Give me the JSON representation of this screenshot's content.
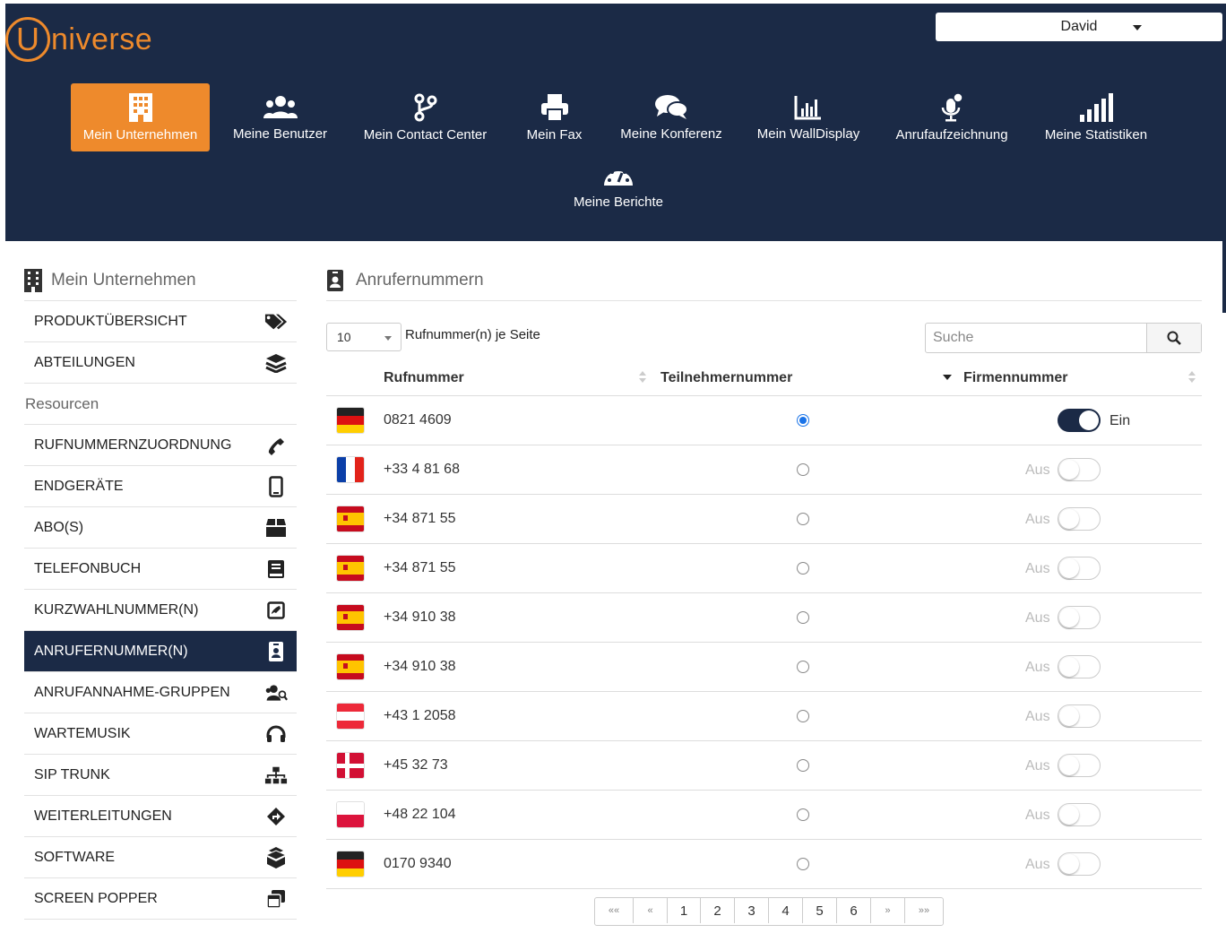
{
  "app": {
    "logo_letter": "U",
    "logo_rest": "niverse",
    "brand_color": "#ee8a2c",
    "navy_color": "#1b2a46"
  },
  "user": {
    "name": "David"
  },
  "nav": [
    {
      "label": "Mein Unternehmen",
      "icon": "building-icon",
      "active": true
    },
    {
      "label": "Meine Benutzer",
      "icon": "users-icon"
    },
    {
      "label": "Mein Contact Center",
      "icon": "branch-icon"
    },
    {
      "label": "Mein Fax",
      "icon": "printer-icon"
    },
    {
      "label": "Meine Konferenz",
      "icon": "chat-bubbles-icon"
    },
    {
      "label": "Mein WallDisplay",
      "icon": "bar-chart-icon"
    },
    {
      "label": "Anrufaufzeichnung",
      "icon": "microphone-icon"
    },
    {
      "label": "Meine Statistiken",
      "icon": "signal-bars-icon"
    },
    {
      "label": "Meine Berichte",
      "icon": "tachometer-icon"
    }
  ],
  "sidebar": {
    "title": "Mein Unternehmen",
    "items_top": [
      {
        "label": "PRODUKTÜBERSICHT",
        "icon": "tags-icon"
      },
      {
        "label": "ABTEILUNGEN",
        "icon": "layers-icon"
      }
    ],
    "section_label": "Resourcen",
    "items": [
      {
        "label": "RUFNUMMERNZUORDNUNG",
        "icon": "phone-icon"
      },
      {
        "label": "ENDGERÄTE",
        "icon": "mobile-icon"
      },
      {
        "label": "ABO(S)",
        "icon": "box-icon"
      },
      {
        "label": "TELEFONBUCH",
        "icon": "book-icon"
      },
      {
        "label": "KURZWAHLNUMMER(N)",
        "icon": "speed-dial-icon"
      },
      {
        "label": "ANRUFERNUMMER(N)",
        "icon": "id-badge-icon",
        "active": true
      },
      {
        "label": "ANRUFANNAHME-GRUPPEN",
        "icon": "user-group-icon"
      },
      {
        "label": "WARTEMUSIK",
        "icon": "headphones-icon"
      },
      {
        "label": "SIP TRUNK",
        "icon": "sitemap-icon"
      },
      {
        "label": "WEITERLEITUNGEN",
        "icon": "directions-icon"
      },
      {
        "label": "SOFTWARE",
        "icon": "software-box-icon"
      },
      {
        "label": "SCREEN POPPER",
        "icon": "window-stack-icon"
      }
    ]
  },
  "main": {
    "title": "Anrufernummern",
    "per_page_value": "10",
    "per_page_label": "Rufnummer(n) je Seite",
    "search_placeholder": "Suche",
    "columns": {
      "number": "Rufnummer",
      "subscriber": "Teilnehmernummer",
      "company": "Firmennummer"
    },
    "rows": [
      {
        "flag": "de",
        "number": "0821 4609",
        "subscriber_selected": true,
        "company": "Ein",
        "company_on": true
      },
      {
        "flag": "fr",
        "number": "+33 4 81 68",
        "subscriber_selected": false,
        "company": "Aus",
        "company_on": false
      },
      {
        "flag": "es",
        "number": "+34 871 55",
        "subscriber_selected": false,
        "company": "Aus",
        "company_on": false
      },
      {
        "flag": "es",
        "number": "+34 871 55",
        "subscriber_selected": false,
        "company": "Aus",
        "company_on": false
      },
      {
        "flag": "es",
        "number": "+34 910 38",
        "subscriber_selected": false,
        "company": "Aus",
        "company_on": false
      },
      {
        "flag": "es",
        "number": "+34 910 38",
        "subscriber_selected": false,
        "company": "Aus",
        "company_on": false
      },
      {
        "flag": "at",
        "number": "+43 1 2058",
        "subscriber_selected": false,
        "company": "Aus",
        "company_on": false
      },
      {
        "flag": "dk",
        "number": "+45 32 73",
        "subscriber_selected": false,
        "company": "Aus",
        "company_on": false
      },
      {
        "flag": "pl",
        "number": "+48 22 104",
        "subscriber_selected": false,
        "company": "Aus",
        "company_on": false
      },
      {
        "flag": "de",
        "number": "0170 9340",
        "subscriber_selected": false,
        "company": "Aus",
        "company_on": false
      }
    ],
    "pagination": {
      "first": "««",
      "prev": "«",
      "pages": [
        "1",
        "2",
        "3",
        "4",
        "5",
        "6"
      ],
      "next": "»",
      "last": "»»"
    }
  }
}
